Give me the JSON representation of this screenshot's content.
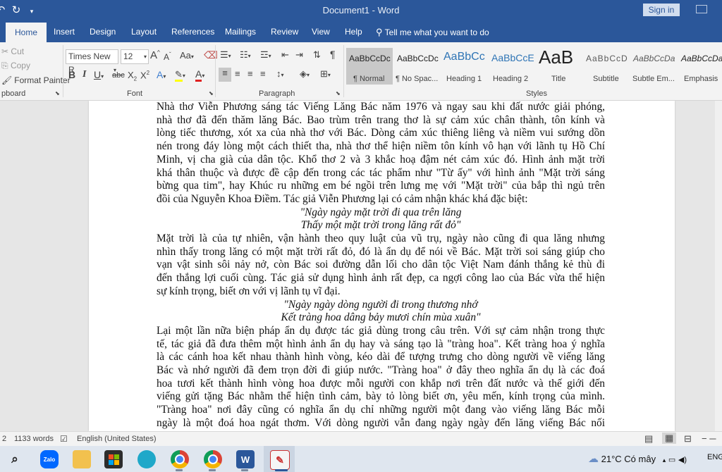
{
  "titlebar": {
    "undo_icon": "undo-icon",
    "redo_icon": "redo-icon",
    "customize_icon": "chevron-down-icon",
    "title": "Document1  -  Word",
    "sign_in": "Sign in"
  },
  "tabs": [
    "Home",
    "Insert",
    "Design",
    "Layout",
    "References",
    "Mailings",
    "Review",
    "View",
    "Help"
  ],
  "tell_me": "Tell me what you want to do",
  "clipboard": {
    "cut": "Cut",
    "copy": "Copy",
    "format_painter": "Format Painter",
    "label": "pboard"
  },
  "font": {
    "name": "Times New R",
    "size": "12",
    "grow": "A",
    "shrink": "A",
    "change_case": "Aa",
    "bold": "B",
    "italic": "I",
    "underline": "U",
    "strike": "abc",
    "subscript": "X",
    "subscript_mark": "2",
    "superscript": "X",
    "superscript_mark": "2",
    "label": "Font"
  },
  "paragraph": {
    "label": "Paragraph"
  },
  "styles": {
    "label": "Styles",
    "items": [
      {
        "sample": "AaBbCcDc",
        "name": "¶ Normal"
      },
      {
        "sample": "AaBbCcDc",
        "name": "¶ No Spac..."
      },
      {
        "sample": "AaBbCc",
        "name": "Heading 1"
      },
      {
        "sample": "AaBbCcE",
        "name": "Heading 2"
      },
      {
        "sample": "AaB",
        "name": "Title"
      },
      {
        "sample": "AaBbCcD",
        "name": "Subtitle"
      },
      {
        "sample": "AaBbCcDa",
        "name": "Subtle Em..."
      },
      {
        "sample": "AaBbCcDa",
        "name": "Emphasis"
      }
    ]
  },
  "document": {
    "lines": [
      {
        "kind": "para",
        "text": "Nhà thơ Viễn Phương sáng tác Viếng Lăng Bác năm 1976 và ngay sau khi đất nước giải phóng,"
      },
      {
        "kind": "para",
        "text": "nhà thơ đã đến thăm lăng Bác. Bao trùm trên trang thơ là sự cảm xúc chân thành, tôn kính và"
      },
      {
        "kind": "para",
        "text": "lòng tiếc thương, xót xa của nhà thơ với Bác. Dòng cảm xúc thiêng liêng và niềm vui sướng dồn"
      },
      {
        "kind": "para",
        "text": "nén trong đáy lòng một cách thiết tha, nhà thơ thể hiện niềm tôn kính vô hạn với lãnh tụ Hồ Chí"
      },
      {
        "kind": "para",
        "text": "Minh, vị cha già của dân tộc. Khổ thơ 2 và 3 khắc hoạ đậm nét cảm xúc đó. Hình ảnh mặt trời"
      },
      {
        "kind": "para",
        "text": "khá thân thuộc và được đề cập đến trong các tác phẩm như \"Từ ấy\" với hình ảnh \"Mặt trời sáng"
      },
      {
        "kind": "para",
        "text": "bừng qua tim\", hay Khúc ru những em bé ngồi trên lưng mẹ với \"Mặt trời\" của bắp thì ngủ trên"
      },
      {
        "kind": "last",
        "text": "đồi của Nguyễn Khoa Điềm. Tác giả Viễn Phương lại có cảm nhận khác khá đặc biệt:"
      },
      {
        "kind": "verse",
        "text": "\"Ngày ngày mặt trời đi qua trên lăng"
      },
      {
        "kind": "verse",
        "text": "Thấy một mặt trời trong lăng rất đỏ\""
      },
      {
        "kind": "para",
        "text": "Mặt trời là của tự nhiên, vận hành theo quy luật của vũ trụ, ngày nào cũng đi qua lăng nhưng"
      },
      {
        "kind": "para",
        "text": "nhìn thấy trong lăng có một mặt trời rất đỏ, đó là ẩn dụ để nói về Bác. Mặt trời soi sáng giúp cho"
      },
      {
        "kind": "para",
        "text": "vạn vật sinh sôi nảy nở, còn Bác soi đường dẫn lối cho dân tộc Việt Nam đánh thắng kẻ thù đi"
      },
      {
        "kind": "para",
        "text": "đến thắng lợi cuối cùng. Tác giả sử dụng hình ảnh rất đẹp, ca ngợi công lao của Bác vừa thể hiện"
      },
      {
        "kind": "last",
        "text": "sự kính trọng, biết ơn với vị lãnh tụ vĩ đại."
      },
      {
        "kind": "verse",
        "text": "\"Ngày ngày dòng người đi trong thương nhớ"
      },
      {
        "kind": "verse",
        "text": "Kết tràng hoa dâng bảy mươi chín mùa xuân\""
      },
      {
        "kind": "para",
        "text": "Lại một lần nữa biện pháp ẩn dụ được tác giả dùng trong câu trên. Với sự cảm nhận trong thực"
      },
      {
        "kind": "para",
        "text": "tế, tác giả đã đưa thêm một hình ảnh ẩn dụ hay và sáng tạo là \"tràng hoa\". Kết tràng hoa ý nghĩa"
      },
      {
        "kind": "para",
        "text": "là các cánh hoa kết nhau thành hình vòng, kéo dài để tượng trưng cho dòng người về viếng lăng"
      },
      {
        "kind": "para",
        "text": "Bác và nhớ người đã đem trọn đời đi giúp nước. \"Tràng hoa\" ở đây theo nghĩa ẩn dụ là các đoá"
      },
      {
        "kind": "para",
        "text": "hoa tươi kết thành hình vòng hoa được mỗi người con khắp nơi trên đất nước và thế giới đến"
      },
      {
        "kind": "para",
        "text": "viếng gửi tặng Bác nhằm thể hiện tình cảm, bày tỏ lòng biết ơn, yêu mến, kính trọng của mình."
      },
      {
        "kind": "para",
        "text": "\"Tràng hoa\" nơi đây cũng có nghĩa ẩn dụ chỉ những người một đang vào viếng lăng Bác mỗi"
      },
      {
        "kind": "para",
        "text": "ngày là một đoá hoa ngát thơm. Với dòng người vẫn đang ngày ngày đến lăng viếng Bác nối"
      }
    ]
  },
  "status": {
    "page": "2",
    "words": "1133 words",
    "language": "English (United States)"
  },
  "taskbar": {
    "apps": [
      "search-icon",
      "zalo-icon",
      "file-explorer-icon",
      "store-icon",
      "edge-icon",
      "chrome-icon",
      "chrome-profile-icon",
      "word-icon",
      "paint-icon"
    ],
    "zalo_label": "Zalo",
    "word_label": "W",
    "temperature": "21°C",
    "weather_text": "Có mây",
    "lang": "ENG"
  },
  "colors": {
    "word_blue": "#2b579a",
    "ribbon_bg": "#f3f3f3",
    "taskbar_bg": "#dfe6ef"
  }
}
